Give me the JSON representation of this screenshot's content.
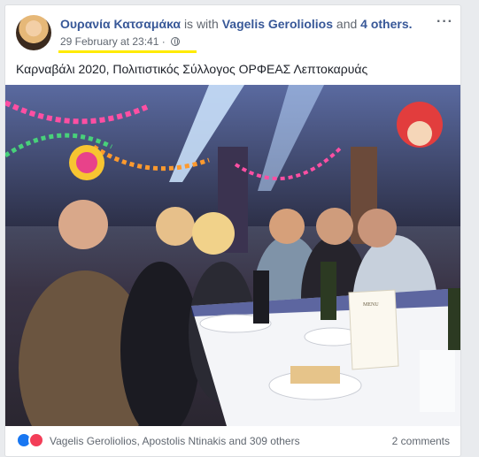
{
  "post": {
    "author": "Ουρανία Κατσαμάκα",
    "with_prefix": "is with",
    "tagged_person": "Vagelis Geroliolios",
    "and_text": "and",
    "tagged_others": "4 others.",
    "more_menu": "···",
    "timestamp": "29 February at 23:41",
    "separator": "·",
    "privacy_icon": "globe-icon",
    "text": "Καρναβάλι 2020, Πολιτιστικός Σύλλογος ΟΡΦΕΑΣ Λεπτοκαρυάς"
  },
  "photo": {
    "menu_card_title": "MENU"
  },
  "reactions": {
    "icons": [
      "like-icon",
      "love-icon"
    ],
    "summary": "Vagelis Geroliolios, Apostolis Ntinakis and 309 others",
    "comments": "2 comments"
  },
  "colors": {
    "link": "#385898",
    "meta": "#606770",
    "highlight": "#ffeb00",
    "like": "#1877f2",
    "love": "#f33e58"
  }
}
